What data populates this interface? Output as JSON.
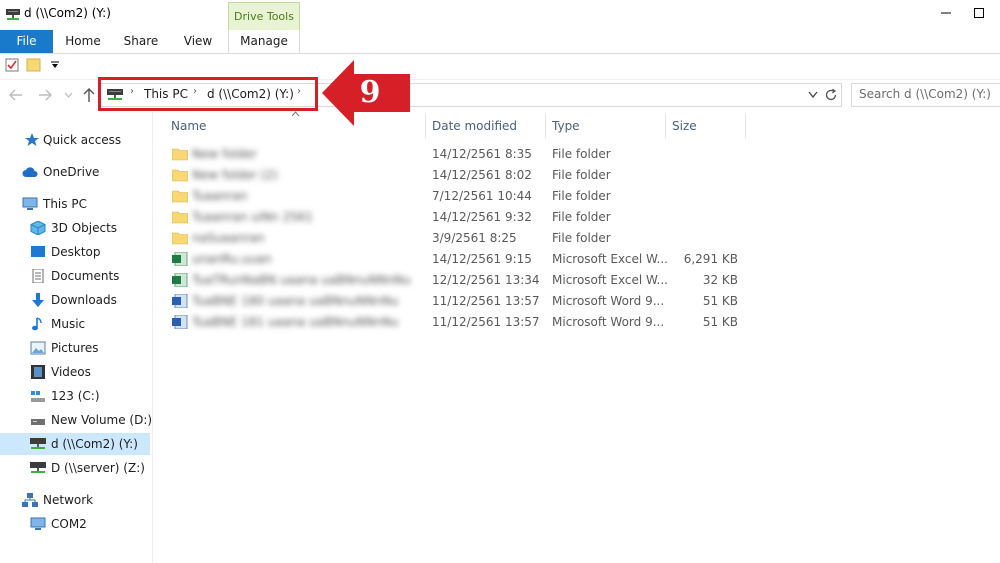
{
  "window": {
    "title": "d (\\\\Com2) (Y:)",
    "drive_tools_label": "Drive Tools"
  },
  "ribbon": {
    "tabs": [
      "File",
      "Home",
      "Share",
      "View",
      "Manage"
    ]
  },
  "address": {
    "crumbs": [
      "This PC",
      "d (\\\\Com2) (Y:)"
    ],
    "search_placeholder": "Search d (\\\\Com2) (Y:)"
  },
  "callout": {
    "number": "9",
    "color": "#d61f26"
  },
  "nav": {
    "quick_access": "Quick access",
    "onedrive": "OneDrive",
    "this_pc": "This PC",
    "objects3d": "3D Objects",
    "desktop": "Desktop",
    "documents": "Documents",
    "downloads": "Downloads",
    "music": "Music",
    "pictures": "Pictures",
    "videos": "Videos",
    "drive_c": "123 (C:)",
    "drive_d": "New Volume (D:)",
    "drive_y": "d (\\\\Com2) (Y:)",
    "drive_z": "D (\\\\server) (Z:)",
    "network": "Network",
    "com2": "COM2"
  },
  "columns": {
    "name": "Name",
    "date": "Date modified",
    "type": "Type",
    "size": "Size"
  },
  "files": [
    {
      "name": "New folder",
      "date": "14/12/2561 8:35",
      "type": "File folder",
      "size": "",
      "kind": "folder"
    },
    {
      "name": "New folder (2)",
      "date": "14/12/2561 8:02",
      "type": "File folder",
      "size": "",
      "kind": "folder"
    },
    {
      "name": "Tuaanran",
      "date": "7/12/2561 10:44",
      "type": "File folder",
      "size": "",
      "kind": "folder"
    },
    {
      "name": "Tuaanran uiNn 2561",
      "date": "14/12/2561 9:32",
      "type": "File folder",
      "size": "",
      "kind": "folder"
    },
    {
      "name": "naSuaanran",
      "date": "3/9/2561 8:25",
      "type": "File folder",
      "size": "",
      "kind": "folder"
    },
    {
      "name": "unanRu.uuan",
      "date": "14/12/2561 9:15",
      "type": "Microsoft Excel W...",
      "size": "6,291 KB",
      "kind": "excel"
    },
    {
      "name": "TuaTRunNaBN uaana uaBNnuNNnNu",
      "date": "12/12/2561 13:34",
      "type": "Microsoft Excel W...",
      "size": "32 KB",
      "kind": "excel"
    },
    {
      "name": "TuaBNE 180 uaana uaBNnuNNnNu",
      "date": "11/12/2561 13:57",
      "type": "Microsoft Word 9...",
      "size": "51 KB",
      "kind": "word"
    },
    {
      "name": "TuaBNE 181 uaana uaBNnuNNnNu",
      "date": "11/12/2561 13:57",
      "type": "Microsoft Word 9...",
      "size": "51 KB",
      "kind": "word"
    }
  ]
}
